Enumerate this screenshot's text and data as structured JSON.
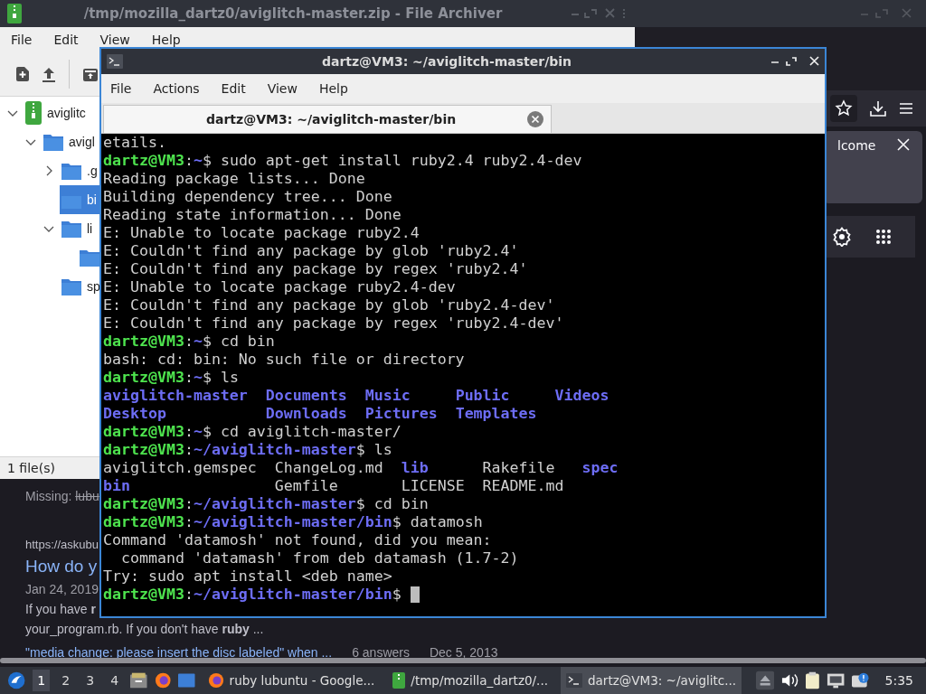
{
  "browser": {
    "notification": {
      "title": "lcome"
    },
    "result": {
      "missing_label": "Missing:",
      "missing_terms": "lubu",
      "url": "https://askubu",
      "title": "How do y",
      "date": "Jan 24, 2019",
      "snippet": "If you have **r**",
      "snippet_2": "your_program.rb. If you don't have **ruby** ..."
    },
    "related": {
      "title": "\"media change: please insert the disc labeled\" when ...",
      "answers": "6 answers",
      "date": "Dec 5, 2013"
    }
  },
  "archiver": {
    "title": "/tmp/mozilla_dartz0/aviglitch-master.zip - File Archiver",
    "menu": [
      "File",
      "Edit",
      "View",
      "Help"
    ],
    "tree": [
      {
        "label": "aviglitc",
        "kind": "archive",
        "expanded": true,
        "selected": false,
        "children": [
          {
            "label": "avigl",
            "kind": "folder",
            "expanded": true,
            "selected": false,
            "children": [
              {
                "label": ".g",
                "kind": "folder",
                "expanded": false,
                "selected": false
              },
              {
                "label": "bi",
                "kind": "folder",
                "selected": true
              },
              {
                "label": "li",
                "kind": "folder",
                "expanded": true,
                "selected": false,
                "children": [
                  {
                    "kind": "folder",
                    "selected": false
                  }
                ]
              },
              {
                "label": "sp",
                "kind": "folder",
                "selected": false
              }
            ]
          }
        ]
      }
    ],
    "status": "1 file(s)"
  },
  "terminal": {
    "title": "dartz@VM3: ~/aviglitch-master/bin",
    "menu": [
      "File",
      "Actions",
      "Edit",
      "View",
      "Help"
    ],
    "tab": {
      "label": "dartz@VM3: ~/aviglitch-master/bin"
    },
    "lines": [
      [
        {
          "text": "etails.",
          "kind": "plain"
        }
      ],
      [
        {
          "text": "dartz@VM3",
          "kind": "user"
        },
        {
          "text": ":",
          "kind": "plain"
        },
        {
          "text": "~",
          "kind": "path"
        },
        {
          "text": "$ sudo apt-get install ruby2.4 ruby2.4-dev",
          "kind": "plain"
        }
      ],
      [
        {
          "text": "Reading package lists... Done",
          "kind": "plain"
        }
      ],
      [
        {
          "text": "Building dependency tree... Done",
          "kind": "plain"
        }
      ],
      [
        {
          "text": "Reading state information... Done",
          "kind": "plain"
        }
      ],
      [
        {
          "text": "E: Unable to locate package ruby2.4",
          "kind": "plain"
        }
      ],
      [
        {
          "text": "E: Couldn't find any package by glob 'ruby2.4'",
          "kind": "plain"
        }
      ],
      [
        {
          "text": "E: Couldn't find any package by regex 'ruby2.4'",
          "kind": "plain"
        }
      ],
      [
        {
          "text": "E: Unable to locate package ruby2.4-dev",
          "kind": "plain"
        }
      ],
      [
        {
          "text": "E: Couldn't find any package by glob 'ruby2.4-dev'",
          "kind": "plain"
        }
      ],
      [
        {
          "text": "E: Couldn't find any package by regex 'ruby2.4-dev'",
          "kind": "plain"
        }
      ],
      [
        {
          "text": "dartz@VM3",
          "kind": "user"
        },
        {
          "text": ":",
          "kind": "plain"
        },
        {
          "text": "~",
          "kind": "path"
        },
        {
          "text": "$ cd bin",
          "kind": "plain"
        }
      ],
      [
        {
          "text": "bash: cd: bin: No such file or directory",
          "kind": "plain"
        }
      ],
      [
        {
          "text": "dartz@VM3",
          "kind": "user"
        },
        {
          "text": ":",
          "kind": "plain"
        },
        {
          "text": "~",
          "kind": "path"
        },
        {
          "text": "$ ls",
          "kind": "plain"
        }
      ],
      [
        {
          "text": "aviglitch-master  ",
          "kind": "dir"
        },
        {
          "text": "Documents  ",
          "kind": "dir"
        },
        {
          "text": "Music     ",
          "kind": "dir"
        },
        {
          "text": "Public     ",
          "kind": "dir"
        },
        {
          "text": "Videos",
          "kind": "dir"
        }
      ],
      [
        {
          "text": "Desktop           ",
          "kind": "dir"
        },
        {
          "text": "Downloads  ",
          "kind": "dir"
        },
        {
          "text": "Pictures  ",
          "kind": "dir"
        },
        {
          "text": "Templates",
          "kind": "dir"
        }
      ],
      [
        {
          "text": "dartz@VM3",
          "kind": "user"
        },
        {
          "text": ":",
          "kind": "plain"
        },
        {
          "text": "~",
          "kind": "path"
        },
        {
          "text": "$ cd aviglitch-master/",
          "kind": "plain"
        }
      ],
      [
        {
          "text": "dartz@VM3",
          "kind": "user"
        },
        {
          "text": ":",
          "kind": "plain"
        },
        {
          "text": "~/aviglitch-master",
          "kind": "path"
        },
        {
          "text": "$ ls",
          "kind": "plain"
        }
      ],
      [
        {
          "text": "aviglitch.gemspec  ChangeLog.md  ",
          "kind": "plain"
        },
        {
          "text": "lib      ",
          "kind": "dir"
        },
        {
          "text": "Rakefile   ",
          "kind": "plain"
        },
        {
          "text": "spec",
          "kind": "dir"
        }
      ],
      [
        {
          "text": "bin                ",
          "kind": "dir"
        },
        {
          "text": "Gemfile       LICENSE  README.md",
          "kind": "plain"
        }
      ],
      [
        {
          "text": "dartz@VM3",
          "kind": "user"
        },
        {
          "text": ":",
          "kind": "plain"
        },
        {
          "text": "~/aviglitch-master",
          "kind": "path"
        },
        {
          "text": "$ cd bin",
          "kind": "plain"
        }
      ],
      [
        {
          "text": "dartz@VM3",
          "kind": "user"
        },
        {
          "text": ":",
          "kind": "plain"
        },
        {
          "text": "~/aviglitch-master/bin",
          "kind": "path"
        },
        {
          "text": "$ datamosh",
          "kind": "plain"
        }
      ],
      [
        {
          "text": "Command 'datamosh' not found, did you mean:",
          "kind": "plain"
        }
      ],
      [
        {
          "text": "  command 'datamash' from deb datamash (1.7-2)",
          "kind": "plain"
        }
      ],
      [
        {
          "text": "Try: sudo apt install <deb name>",
          "kind": "plain"
        }
      ],
      [
        {
          "text": "dartz@VM3",
          "kind": "user"
        },
        {
          "text": ":",
          "kind": "plain"
        },
        {
          "text": "~/aviglitch-master/bin",
          "kind": "path"
        },
        {
          "text": "$ ",
          "kind": "plain"
        }
      ]
    ]
  },
  "taskbar": {
    "workspaces": [
      {
        "label": "1",
        "selected": true
      },
      {
        "label": "2",
        "selected": false
      },
      {
        "label": "3",
        "selected": false
      },
      {
        "label": "4",
        "selected": false
      }
    ],
    "tasks": [
      {
        "label": "ruby lubuntu - Google...",
        "kind": "browser",
        "selected": false
      },
      {
        "label": "/tmp/mozilla_dartz0/...",
        "kind": "archive",
        "selected": false
      },
      {
        "label": "dartz@VM3: ~/aviglitc...",
        "kind": "terminal",
        "selected": true
      }
    ],
    "clock": "5:35"
  }
}
